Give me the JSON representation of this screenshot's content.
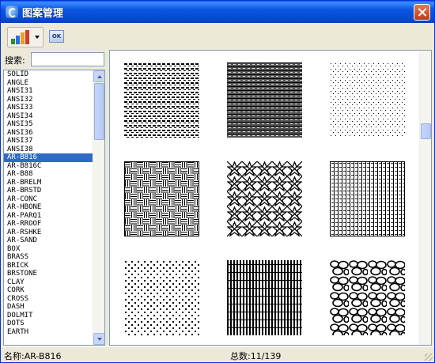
{
  "window": {
    "title": "图案管理"
  },
  "toolbar": {
    "ok_label": "OK"
  },
  "search": {
    "label": "搜索:",
    "value": "",
    "placeholder": ""
  },
  "patterns": [
    "SOLID",
    "ANGLE",
    "ANSI31",
    "ANSI32",
    "ANSI33",
    "ANSI34",
    "ANSI35",
    "ANSI36",
    "ANSI37",
    "ANSI38",
    "AR-B816",
    "AR-B816C",
    "AR-B88",
    "AR-BRELM",
    "AR-BRSTD",
    "AR-CONC",
    "AR-HBONE",
    "AR-PARQ1",
    "AR-RROOF",
    "AR-RSHKE",
    "AR-SAND",
    "BOX",
    "BRASS",
    "BRICK",
    "BRSTONE",
    "CLAY",
    "CORK",
    "CROSS",
    "DASH",
    "DOLMIT",
    "DOTS",
    "EARTH"
  ],
  "selected_index": 10,
  "preview_tiles": [
    "dash-rows",
    "hatched-rows",
    "dot-rows",
    "weave",
    "stars",
    "grid-dashes",
    "dot-field",
    "vertical-lines",
    "stones"
  ],
  "status": {
    "name_text": "名称:AR-B816",
    "total_text": "总数:11/139"
  },
  "colors": {
    "selection": "#316ac5",
    "title_bar": "#0a55e0",
    "window_bg": "#ece9d8"
  }
}
